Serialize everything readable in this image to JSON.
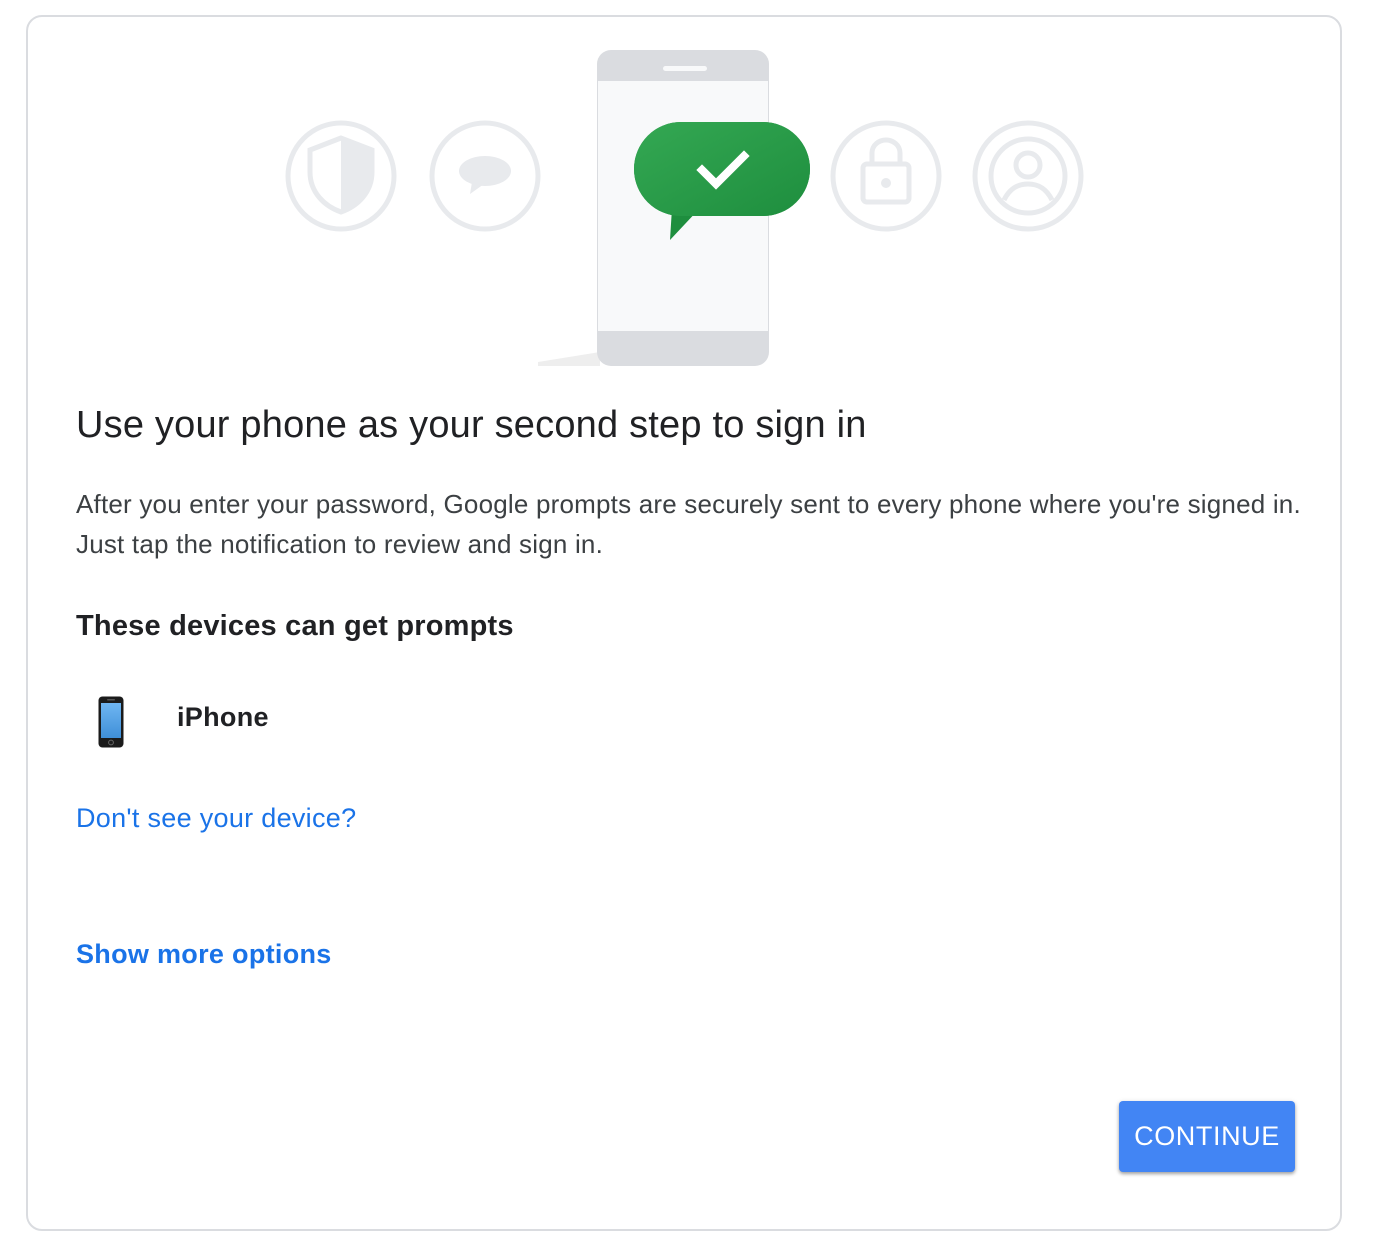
{
  "main": {
    "title": "Use your phone as your second step to sign in",
    "description": "After you enter your password, Google prompts are securely sent to every phone where you're signed in. Just tap the notification to review and sign in.",
    "devices_heading": "These devices can get prompts",
    "devices": [
      {
        "name": "iPhone",
        "icon": "iphone-icon"
      }
    ],
    "dont_see_device_link": "Don't see your device?",
    "show_more_options_link": "Show more options",
    "continue_label": "CONTINUE"
  },
  "illustration": {
    "icons": [
      "shield-icon",
      "chat-bubble-icon",
      "phone-icon",
      "checkmark-icon",
      "lock-icon",
      "account-icon"
    ]
  },
  "colors": {
    "accent": "#4285f4",
    "link": "#1a73e8",
    "success_green": "#1e8e3e",
    "text_primary": "#202124",
    "text_secondary": "#3c4043"
  }
}
